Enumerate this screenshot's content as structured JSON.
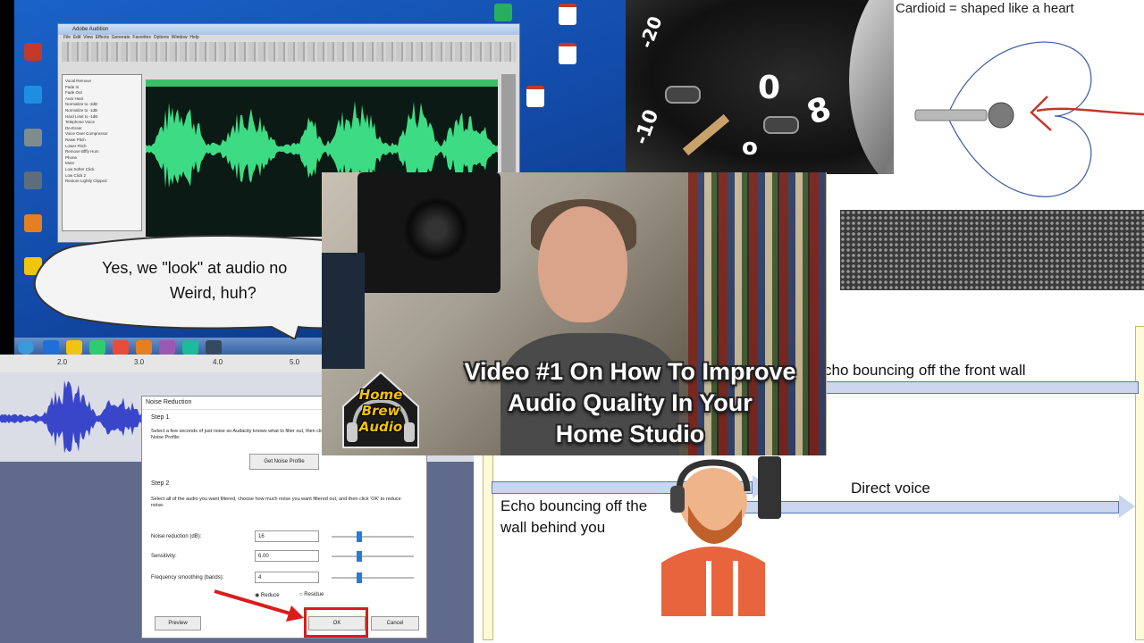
{
  "bubble": {
    "line1": "Yes, we \"look\" at audio no",
    "line2": "Weird, huh?"
  },
  "editor": {
    "title": "Adobe Audition",
    "menu": [
      "File",
      "Edit",
      "View",
      "Effects",
      "Generate",
      "Favorites",
      "Options",
      "Window",
      "Help"
    ],
    "effects": [
      "Vocal Remove",
      "Fade In",
      "Fade Out",
      "Auto Heal",
      "Normalize to -3dB",
      "Normalize to -1dB",
      "Hard Limit to -1dB",
      "Telephone Voice",
      "De-Esser",
      "Voice Over Compressor",
      "Raise Pitch",
      "Lower Pitch",
      "Remove Bfffy Hum",
      "Phone",
      "Mute",
      "Low Softer Click",
      "Low Click 2",
      "Restore Lightly Clipped"
    ]
  },
  "cardioid": {
    "title": "Cardioid = shaped like a heart"
  },
  "mic_dial": {
    "labels": [
      "0",
      "-10",
      "-20",
      "8",
      "o"
    ]
  },
  "echo": {
    "front_wall": "cho bouncing off the front wall",
    "direct": "Direct voice",
    "behind_line1": "Echo bouncing off the",
    "behind_line2": "wall behind you"
  },
  "noise_reduction": {
    "title": "Noise Reduction",
    "step1": "Step 1",
    "step1_text": "Select a few seconds of just noise so Audacity knows what to filter out, then click Get Noise Profile:",
    "get_profile": "Get Noise Profile",
    "step2": "Step 2",
    "step2_text": "Select all of the audio you want filtered, choose how much noise you want filtered out, and then click 'OK' to reduce noise.",
    "reduction_label": "Noise reduction (dB):",
    "reduction_value": "16",
    "sensitivity_label": "Sensitivity:",
    "sensitivity_value": "6.00",
    "smoothing_label": "Frequency smoothing (bands):",
    "smoothing_value": "4",
    "reduce": "Reduce",
    "residue": "Residue",
    "preview": "Preview",
    "ok": "OK",
    "cancel": "Cancel"
  },
  "ruler": {
    "ticks": [
      "2.0",
      "3.0",
      "4.0",
      "5.0"
    ]
  },
  "video": {
    "title_line1": "Video #1 On How To Improve",
    "title_line2": "Audio Quality In Your",
    "title_line3": "Home Studio",
    "logo_line1": "Home",
    "logo_line2": "Brew",
    "logo_line3": "Audio"
  },
  "colors": {
    "ok_highlight": "#d91c1c",
    "arrow_red": "#d91c1c",
    "waveform_green": "#3ddc84",
    "waveform_blue": "#3a46c9",
    "echo_arrow": "#c9d6ee"
  }
}
